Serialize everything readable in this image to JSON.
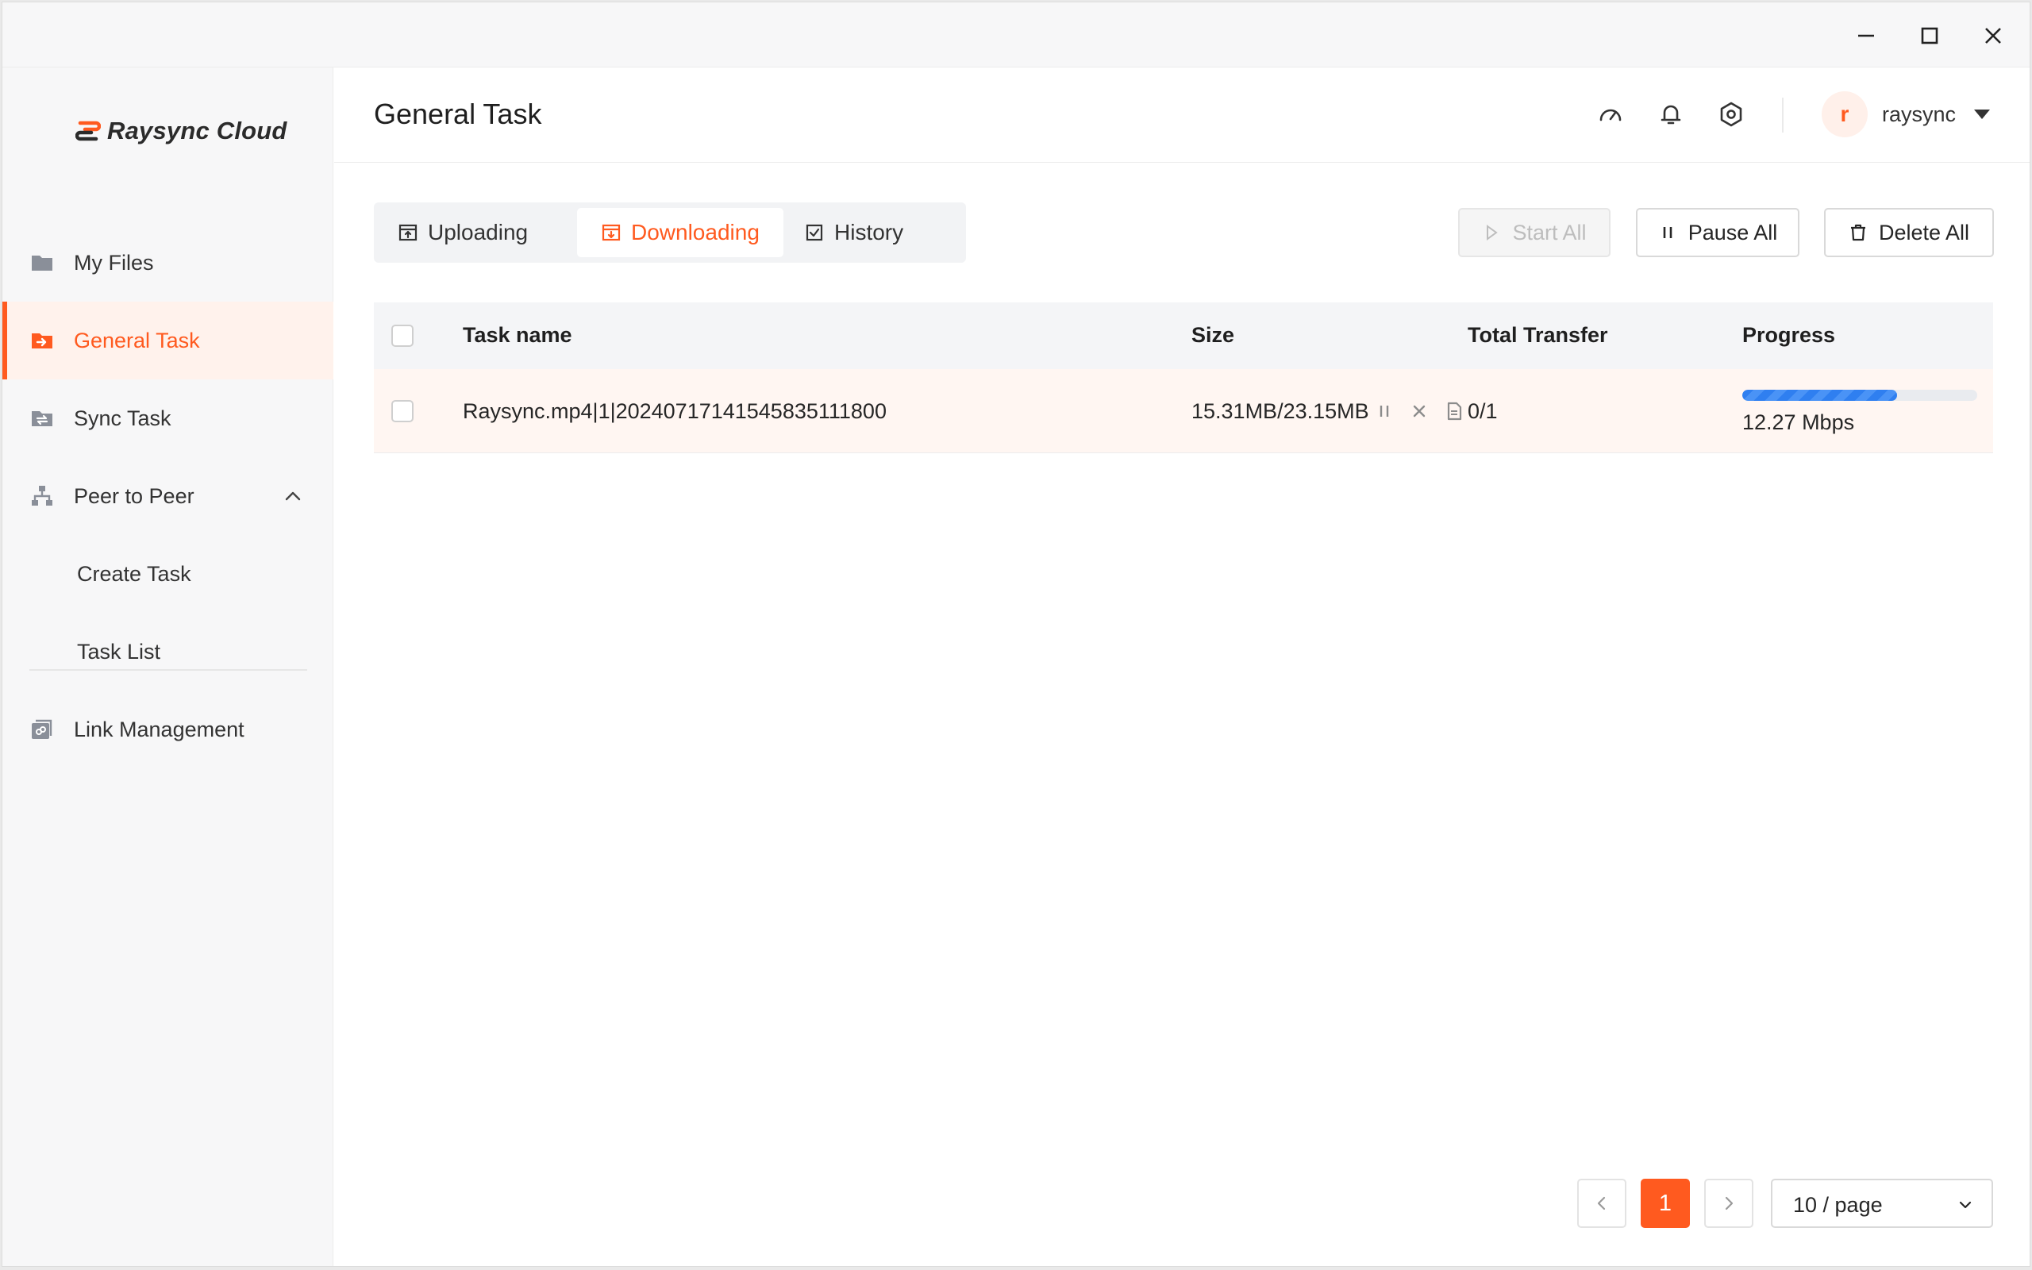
{
  "app": {
    "brand": "Raysync Cloud",
    "accent": "#ff5a1f"
  },
  "window_controls": {
    "minimize": "minimize-icon",
    "maximize": "maximize-icon",
    "close": "close-icon"
  },
  "sidebar": {
    "items": [
      {
        "label": "My Files",
        "icon": "folder-icon"
      },
      {
        "label": "General Task",
        "icon": "task-transfer-icon",
        "active": true
      },
      {
        "label": "Sync Task",
        "icon": "sync-icon"
      },
      {
        "label": "Peer to Peer",
        "icon": "network-icon",
        "expanded": true
      },
      {
        "label": "Create Task"
      },
      {
        "label": "Task List"
      },
      {
        "label": "Link Management",
        "icon": "link-icon"
      }
    ]
  },
  "header": {
    "title": "General Task",
    "icons": [
      "speedometer-icon",
      "bell-icon",
      "settings-icon"
    ],
    "user": {
      "initial": "r",
      "name": "raysync"
    }
  },
  "tabs": [
    {
      "label": "Uploading",
      "icon": "upload-icon"
    },
    {
      "label": "Downloading",
      "icon": "download-icon",
      "active": true
    },
    {
      "label": "History",
      "icon": "check-square-icon"
    }
  ],
  "actions": {
    "start_all": "Start All",
    "pause_all": "Pause All",
    "delete_all": "Delete All"
  },
  "table": {
    "columns": [
      "Task name",
      "Size",
      "Total Transfer",
      "Progress"
    ],
    "rows": [
      {
        "name": "Raysync.mp4|1|20240717141545835111800",
        "size": "15.31MB/23.15MB",
        "total_transfer": "0/1",
        "progress": 0.66,
        "speed": "12.27 Mbps"
      }
    ]
  },
  "pagination": {
    "current": "1",
    "page_size": "10 / page"
  }
}
